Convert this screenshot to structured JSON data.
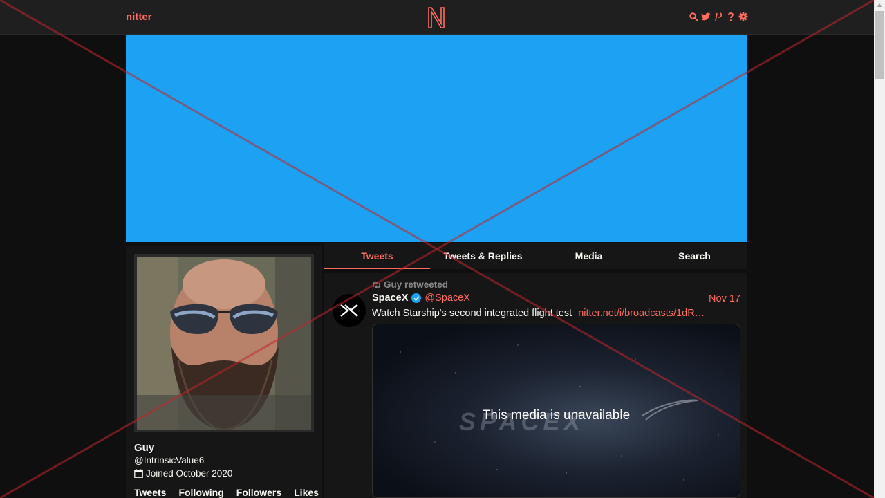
{
  "navbar": {
    "brand": "nitter",
    "logo_letter": "N",
    "icons": [
      "search-icon",
      "twitter-icon",
      "rss-icon",
      "help-icon",
      "settings-icon"
    ]
  },
  "colors": {
    "accent": "#ff6c60",
    "banner": "#1da1f2",
    "background": "#0f0f0f",
    "card": "#161616"
  },
  "profile": {
    "name": "Guy",
    "handle": "@IntrinsicValue6",
    "joined": "Joined October 2020",
    "stats": [
      "Tweets",
      "Following",
      "Followers",
      "Likes"
    ]
  },
  "tabs": [
    {
      "label": "Tweets",
      "active": true
    },
    {
      "label": "Tweets & Replies",
      "active": false
    },
    {
      "label": "Media",
      "active": false
    },
    {
      "label": "Search",
      "active": false
    }
  ],
  "tweet": {
    "retweet_header": "Guy retweeted",
    "fullname": "SpaceX",
    "username": "@SpaceX",
    "date": "Nov 17",
    "text": "Watch Starship's second integrated flight test",
    "link": "nitter.net/i/broadcasts/1dR…",
    "media_message": "This media is unavailable",
    "media_watermark": "SPACEX"
  }
}
